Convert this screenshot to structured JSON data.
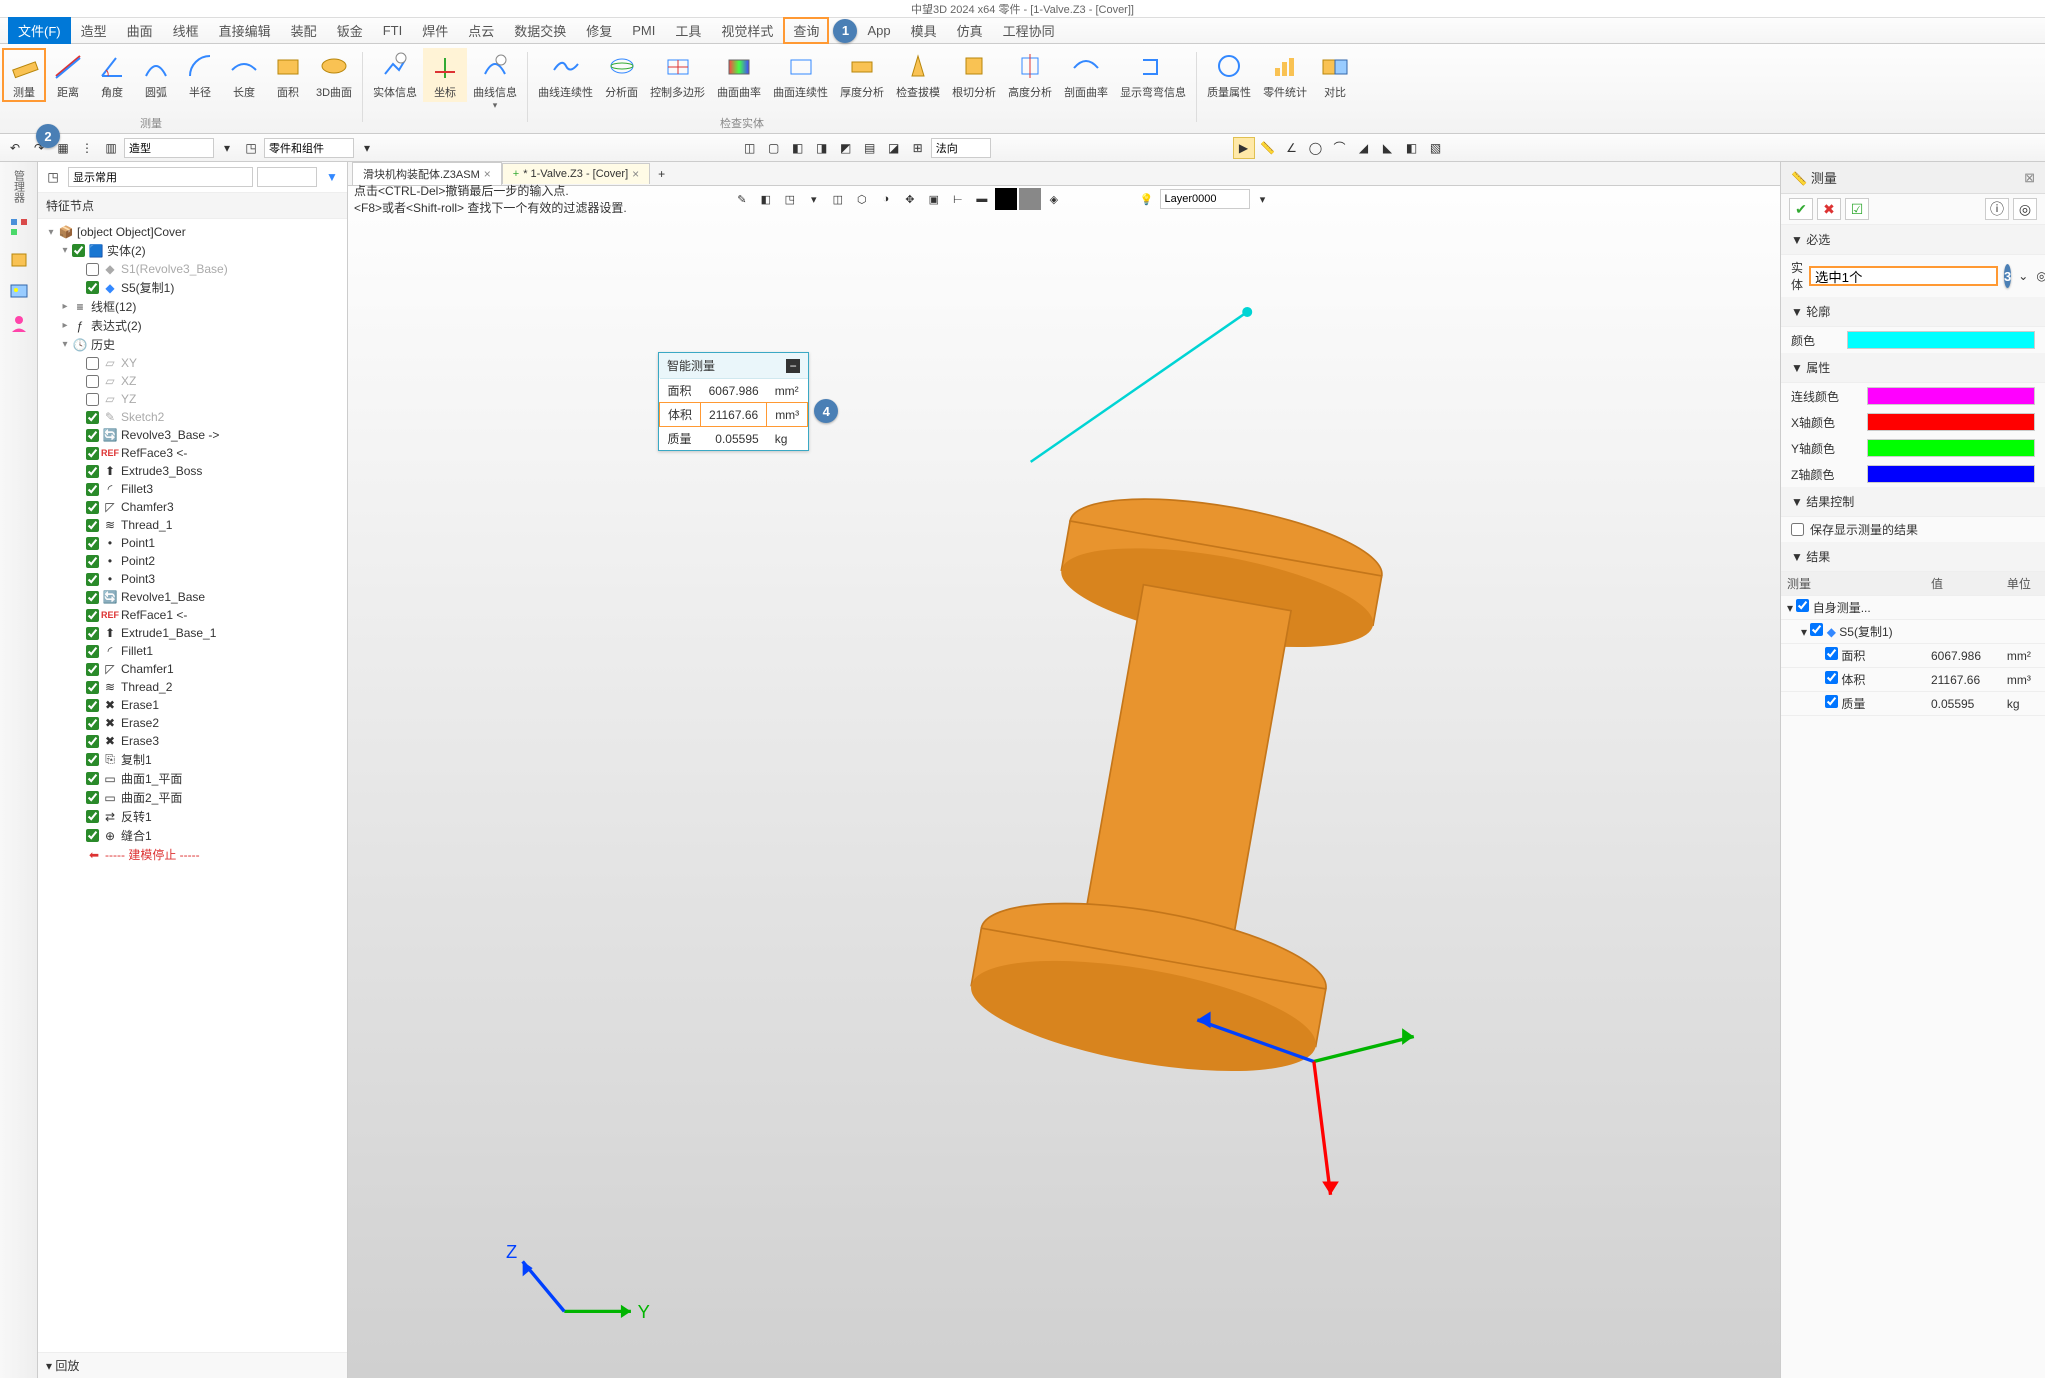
{
  "title": "中望3D 2024 x64     零件 - [1-Valve.Z3 - [Cover]]",
  "menu": {
    "file": "文件(F)",
    "shape": "造型",
    "surface": "曲面",
    "wire": "线框",
    "direct_edit": "直接编辑",
    "assembly": "装配",
    "sheet": "钣金",
    "fti": "FTI",
    "weld": "焊件",
    "pointcloud": "点云",
    "data_ex": "数据交换",
    "repair": "修复",
    "pmi": "PMI",
    "tools": "工具",
    "view_style": "视觉样式",
    "query": "查询",
    "app": "App",
    "mold": "模具",
    "sim": "仿真",
    "collab": "工程协同"
  },
  "toolbar": {
    "measure": "测量",
    "distance": "距离",
    "angle": "角度",
    "arc": "圆弧",
    "radius": "半径",
    "length": "长度",
    "area": "面积",
    "surface3d": "3D曲面",
    "entity_info": "实体信息",
    "coord": "坐标",
    "curve_info": "曲线信息",
    "curve_cont": "曲线连续性",
    "sect_face": "分析面",
    "ctrl_poly": "控制多边形",
    "surf_curv": "曲面曲率",
    "surf_cont": "曲面连续性",
    "thick_anal": "厚度分析",
    "check_draft": "检查拔模",
    "root_anal": "根切分析",
    "height_anal": "高度分析",
    "sect_curv": "剖面曲率",
    "show_bend": "显示弯弯信息",
    "qual_attr": "质量属性",
    "part_stat": "零件统计",
    "compare": "对比",
    "group1": "测量",
    "group2": "检查实体"
  },
  "quickbar": {
    "style_label": "造型",
    "parts_label": "零件和组件",
    "direction": "法向"
  },
  "manager": {
    "title": "管理器",
    "display_label": "显示常用",
    "tree_title": "特征节点",
    "root": "Cover",
    "nodes": {
      "entity": "实体(2)",
      "s1": "S1(Revolve3_Base)",
      "s5": "S5(复制1)",
      "wire": "线框(12)",
      "expr": "表达式(2)",
      "history": "历史",
      "xy": "XY",
      "xz": "XZ",
      "yz": "YZ",
      "sketch2": "Sketch2",
      "rev3": "Revolve3_Base ->",
      "refface3": "RefFace3 <-",
      "ext3": "Extrude3_Boss",
      "fillet3": "Fillet3",
      "chamfer3": "Chamfer3",
      "thread1": "Thread_1",
      "point1": "Point1",
      "point2": "Point2",
      "point3": "Point3",
      "rev1": "Revolve1_Base",
      "refface1": "RefFace1 <-",
      "ext1": "Extrude1_Base_1",
      "fillet1": "Fillet1",
      "chamfer1": "Chamfer1",
      "thread2": "Thread_2",
      "erase1": "Erase1",
      "erase2": "Erase2",
      "erase3": "Erase3",
      "copy1": "复制1",
      "face1p": "曲面1_平面",
      "face2p": "曲面2_平面",
      "flip1": "反转1",
      "merge1": "缝合1",
      "stop": "----- 建模停止 -----"
    },
    "replay": "回放"
  },
  "tabs": {
    "tab1": "滑块机构装配体.Z3ASM",
    "tab2": "* 1-Valve.Z3 - [Cover]"
  },
  "viewport": {
    "hint1": "点击<CTRL-Del>撤销最后一步的输入点.",
    "hint2": "<F8>或者<Shift-roll> 查找下一个有效的过滤器设置.",
    "layer": "Layer0000"
  },
  "float": {
    "title": "智能测量",
    "area_l": "面积",
    "area_v": "6067.986",
    "area_u": "mm²",
    "vol_l": "体积",
    "vol_v": "21167.66",
    "vol_u": "mm³",
    "mass_l": "质量",
    "mass_v": "0.05595",
    "mass_u": "kg"
  },
  "right": {
    "title": "测量",
    "sec_required": "必选",
    "entity_l": "实体",
    "entity_v": "选中1个",
    "sec_outline": "轮廓",
    "color_l": "颜色",
    "sec_attr": "属性",
    "line_color": "连线颜色",
    "x_color": "X轴颜色",
    "y_color": "Y轴颜色",
    "z_color": "Z轴颜色",
    "sec_result_ctrl": "结果控制",
    "keep_result": "保存显示测量的结果",
    "sec_results": "结果",
    "col_measure": "测量",
    "col_value": "值",
    "col_unit": "单位",
    "r_self": "自身测量...",
    "r_s5": "S5(复制1)",
    "r_area_l": "面积",
    "r_area_v": "6067.986",
    "r_area_u": "mm²",
    "r_vol_l": "体积",
    "r_vol_v": "21167.66",
    "r_vol_u": "mm³",
    "r_mass_l": "质量",
    "r_mass_v": "0.05595",
    "r_mass_u": "kg"
  },
  "colors": {
    "outline": "#00ffff",
    "line": "#ff00ff",
    "x": "#ff0000",
    "y": "#00ff00",
    "z": "#0000ff"
  }
}
